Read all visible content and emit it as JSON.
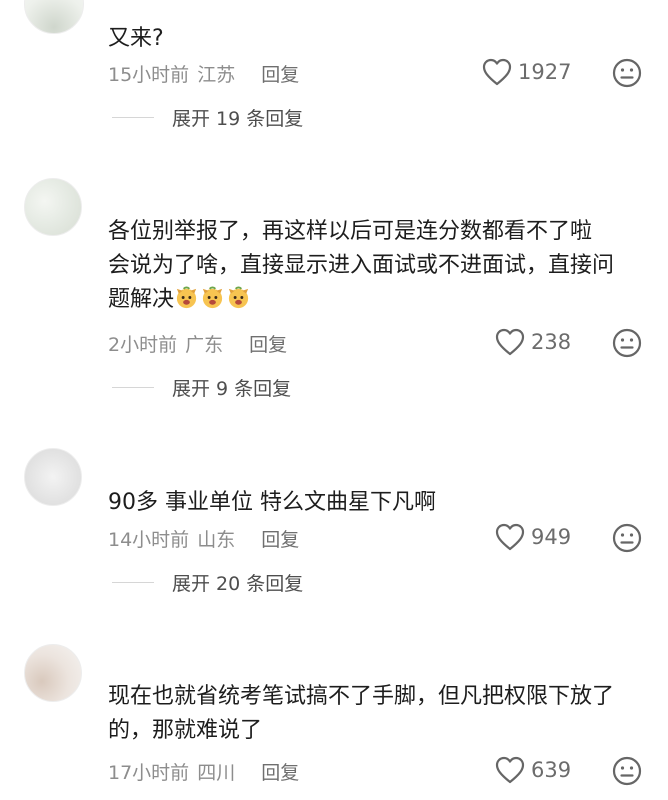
{
  "comments": [
    {
      "username": "",
      "text": "又来?",
      "time": "15小时前",
      "location": "江苏",
      "reply_label": "回复",
      "likes": "1927",
      "expand_label": "展开 19 条回复"
    },
    {
      "username": "",
      "text_line1": "各位别举报了，再这样以后可是连分数都看不了啦",
      "text_line2": "会说为了啥，直接显示进入面试或不进面试，直接问",
      "text_line3": "题解决",
      "emoji_icons": [
        "dog-face-emoji",
        "dog-face-emoji",
        "dog-face-emoji"
      ],
      "time": "2小时前",
      "location": "广东",
      "reply_label": "回复",
      "likes": "238",
      "expand_label": "展开 9 条回复"
    },
    {
      "username": "",
      "text": "90多 事业单位 特么文曲星下凡啊",
      "time": "14小时前",
      "location": "山东",
      "reply_label": "回复",
      "likes": "949",
      "expand_label": "展开 20 条回复"
    },
    {
      "username": "",
      "text_line1": "现在也就省统考笔试搞不了手脚，但凡把权限下放了",
      "text_line2": "的，那就难说了",
      "time": "17小时前",
      "location": "四川",
      "reply_label": "回复",
      "likes": "639"
    }
  ],
  "icons": {
    "like": "heart-outline-icon",
    "dislike": "meh-face-icon"
  },
  "colors": {
    "text": "#1d1d1d",
    "meta": "#8d8d8d",
    "icon": "#6c6c6c"
  }
}
